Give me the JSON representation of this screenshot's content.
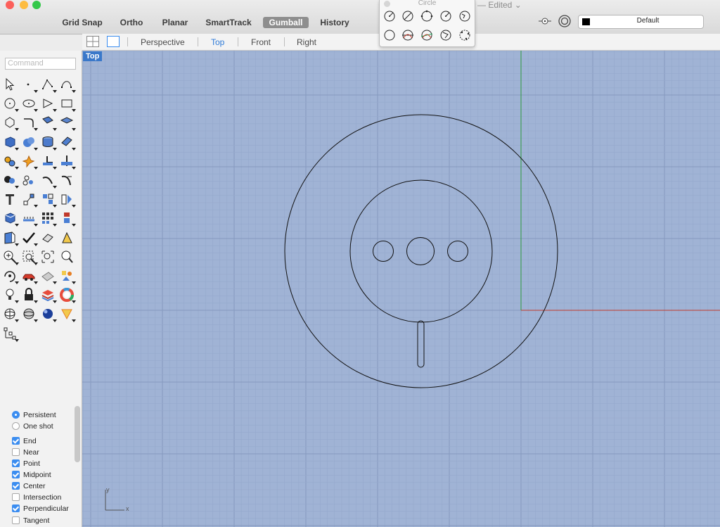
{
  "titlebar": {
    "toggles": [
      "Grid Snap",
      "Ortho",
      "Planar",
      "SmartTrack",
      "Gumball",
      "History"
    ],
    "active_toggle": "Gumball",
    "edited_label": "— Edited ⌄",
    "layer_name": "Default"
  },
  "circle_palette": {
    "title": "Circle",
    "tools": [
      "circle-center-radius-icon",
      "circle-diameter-icon",
      "circle-3point-icon",
      "circle-tangent-icon",
      "circle-around-curve-icon",
      "circle-deformable-icon",
      "circle-tangent-tangent-icon",
      "circle-fit-points-icon",
      "circle-vertical-icon",
      "circle-tangent-3-icon"
    ]
  },
  "viewport_tabs": {
    "items": [
      "Perspective",
      "Top",
      "Front",
      "Right"
    ],
    "active": "Top"
  },
  "viewport": {
    "label": "Top",
    "axis_x": "x",
    "axis_y": "y"
  },
  "command": {
    "placeholder": "Command"
  },
  "osnap": {
    "modes": [
      {
        "label": "Persistent",
        "selected": true
      },
      {
        "label": "One shot",
        "selected": false
      }
    ],
    "snaps": [
      {
        "label": "End",
        "checked": true
      },
      {
        "label": "Near",
        "checked": false
      },
      {
        "label": "Point",
        "checked": true
      },
      {
        "label": "Midpoint",
        "checked": true
      },
      {
        "label": "Center",
        "checked": true
      },
      {
        "label": "Intersection",
        "checked": false
      },
      {
        "label": "Perpendicular",
        "checked": true
      },
      {
        "label": "Tangent",
        "checked": false
      }
    ]
  },
  "colors": {
    "viewport_bg": "#a0b3d5",
    "grid_minor": "#93a7cb",
    "grid_major": "#8699be",
    "x_axis": "#c0392b",
    "y_axis": "#2e9a3e",
    "curve": "#111111",
    "accent": "#3b8df0"
  }
}
